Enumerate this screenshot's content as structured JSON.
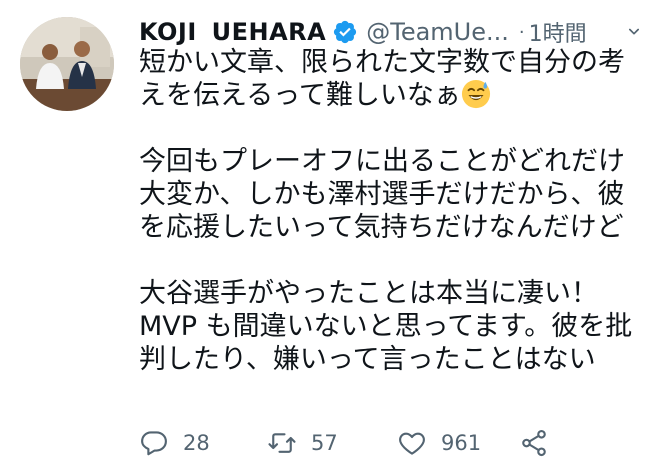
{
  "tweet": {
    "author": {
      "display_name": "KOJI  UEHARA",
      "handle": "@TeamUe...",
      "verified": true
    },
    "separator": "·",
    "timestamp": "1時間",
    "text_parts": {
      "p1_before_emoji": "短かい文章、限られた文字数で自分の考えを伝えるって難しいなぁ",
      "p1_emoji": "sweat-smile-emoji",
      "p2": "今回もプレーオフに出ることがどれだけ大変か、しかも澤村選手だけだから、彼を応援したいって気持ちだけなんだけど",
      "p3": "大谷選手がやったことは本当に凄い！MVP も間違いないと思ってます。彼を批判したり、嫌いって言ったことはない"
    },
    "actions": {
      "reply_count": "28",
      "retweet_count": "57",
      "like_count": "961"
    }
  },
  "icons": {
    "verified": "verified-badge-icon",
    "more": "more-icon",
    "reply": "reply-icon",
    "retweet": "retweet-icon",
    "like": "heart-icon",
    "share": "share-icon"
  },
  "colors": {
    "verified_blue": "#1d9bf0",
    "secondary_text": "#536471",
    "primary_text": "#0f1419"
  }
}
